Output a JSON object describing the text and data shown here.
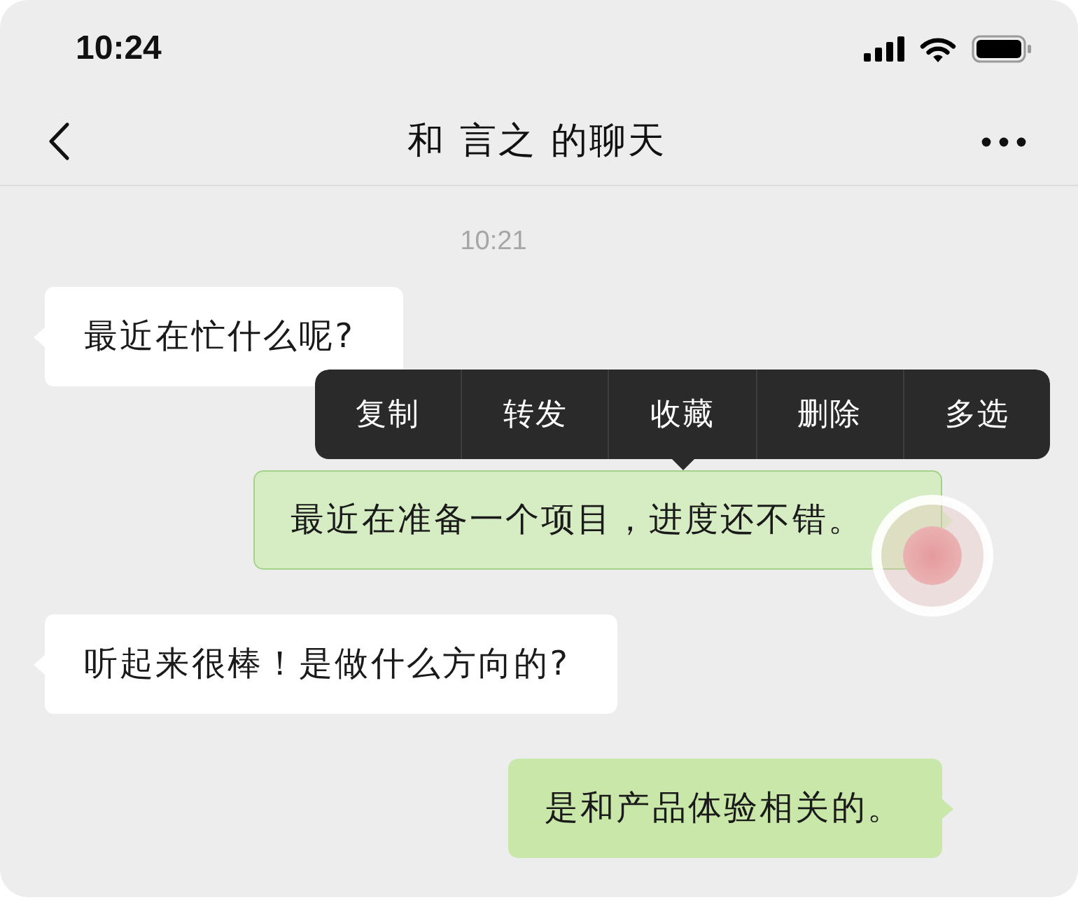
{
  "status_bar": {
    "time": "10:24"
  },
  "nav_bar": {
    "title": "和 言之 的聊天"
  },
  "chat": {
    "timestamp": "10:21",
    "messages": [
      {
        "kind": "incoming",
        "text": "最近在忙什么呢?",
        "selected": false
      },
      {
        "kind": "outgoing",
        "text": "最近在准备一个项目，进度还不错。",
        "selected": true
      },
      {
        "kind": "incoming",
        "text": "听起来很棒！是做什么方向的?",
        "selected": false
      },
      {
        "kind": "outgoing",
        "text": "是和产品体验相关的。",
        "selected": false
      }
    ]
  },
  "context_menu": {
    "items": [
      "复制",
      "转发",
      "收藏",
      "删除",
      "多选"
    ]
  }
}
